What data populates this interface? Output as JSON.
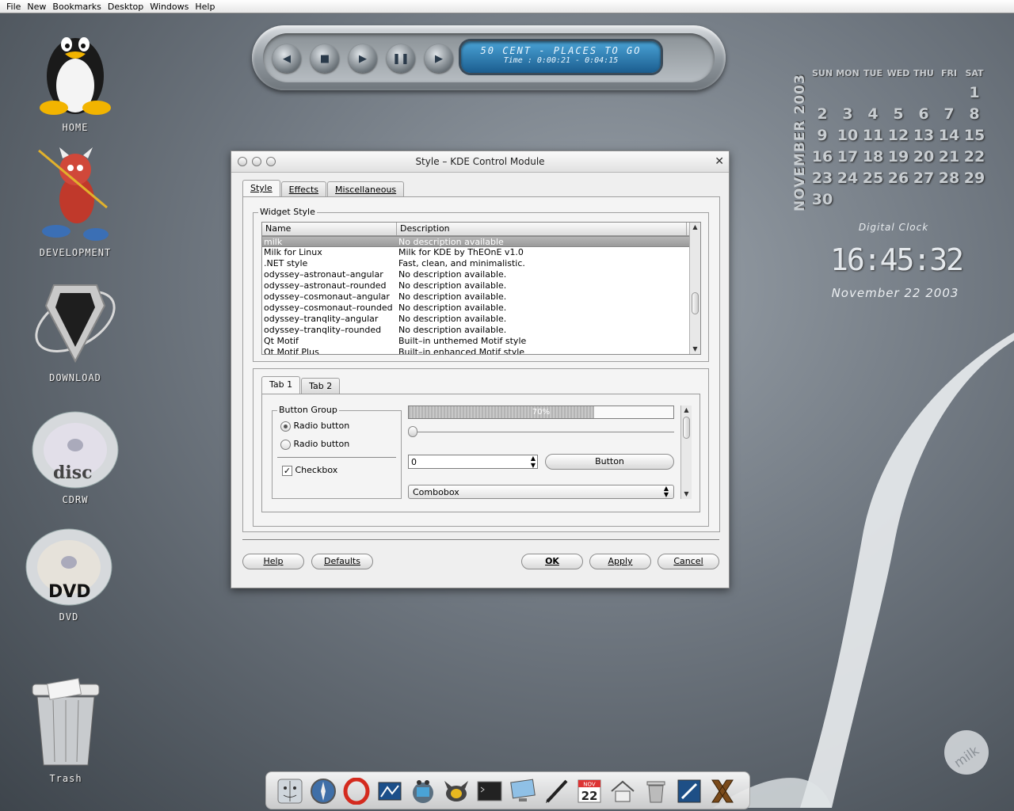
{
  "menubar": [
    "File",
    "New",
    "Bookmarks",
    "Desktop",
    "Windows",
    "Help"
  ],
  "desktop_icons": {
    "home": "HOME",
    "development": "DEVELOPMENT",
    "download": "DOWNLOAD",
    "cdrw": "CDRW",
    "dvd": "DVD",
    "trash": "Trash"
  },
  "player": {
    "track": "50 CENT - PLACES TO GO",
    "time": "Time : 0:00:21 - 0:04:15",
    "buttons": [
      "prev-icon",
      "stop-icon",
      "play-icon",
      "pause-icon",
      "next-icon"
    ]
  },
  "calendar": {
    "month_label": "NOVEMBER 2003",
    "weekdays": [
      "SUN",
      "MON",
      "TUE",
      "WED",
      "THU",
      "FRI",
      "SAT"
    ],
    "weeks": [
      [
        "",
        "",
        "",
        "",
        "",
        "",
        "1"
      ],
      [
        "2",
        "3",
        "4",
        "5",
        "6",
        "7",
        "8"
      ],
      [
        "9",
        "10",
        "11",
        "12",
        "13",
        "14",
        "15"
      ],
      [
        "16",
        "17",
        "18",
        "19",
        "20",
        "21",
        "22"
      ],
      [
        "23",
        "24",
        "25",
        "26",
        "27",
        "28",
        "29"
      ],
      [
        "30",
        "",
        "",
        "",
        "",
        "",
        ""
      ]
    ]
  },
  "clock": {
    "title": "Digital Clock",
    "time": "16:45:32",
    "date": "November 22 2003"
  },
  "dialog": {
    "title": "Style – KDE Control Module",
    "tabs": [
      "Style",
      "Effects",
      "Miscellaneous"
    ],
    "widget_style_label": "Widget Style",
    "columns": [
      "Name",
      "Description"
    ],
    "styles": [
      {
        "name": "milk",
        "desc": "No description available"
      },
      {
        "name": "Milk for Linux",
        "desc": "Milk for KDE by ThEOnE v1.0"
      },
      {
        "name": ".NET style",
        "desc": "Fast, clean, and minimalistic."
      },
      {
        "name": "odyssey–astronaut–angular",
        "desc": "No description available."
      },
      {
        "name": "odyssey–astronaut–rounded",
        "desc": "No description available."
      },
      {
        "name": "odyssey–cosmonaut–angular",
        "desc": "No description available."
      },
      {
        "name": "odyssey–cosmonaut–rounded",
        "desc": "No description available."
      },
      {
        "name": "odyssey–tranqlity–angular",
        "desc": "No description available."
      },
      {
        "name": "odyssey–tranqlity–rounded",
        "desc": "No description available."
      },
      {
        "name": "Qt Motif",
        "desc": "Built–in unthemed Motif style"
      },
      {
        "name": "Qt Motif Plus",
        "desc": "Built–in enhanced Motif style"
      }
    ],
    "selected_style": "milk",
    "preview": {
      "tabs": [
        "Tab 1",
        "Tab 2"
      ],
      "button_group_label": "Button Group",
      "radio1": "Radio button",
      "radio2": "Radio button",
      "checkbox": "Checkbox",
      "progress_text": "70%",
      "progress_value": 0.7,
      "spin_value": "0",
      "button": "Button",
      "combobox": "Combobox"
    },
    "buttons": {
      "help": "Help",
      "defaults": "Defaults",
      "ok": "OK",
      "apply": "Apply",
      "cancel": "Cancel"
    }
  },
  "dock": {
    "items": [
      "finder-icon",
      "safari-icon",
      "opera-icon",
      "konqueror-icon",
      "mail-icon",
      "gimp-icon",
      "terminal-icon",
      "monitor-icon",
      "pen-icon",
      "calendar-icon",
      "home-icon",
      "trash-icon",
      "kde-control-icon",
      "x11-icon"
    ],
    "calendar_month": "NOV",
    "calendar_day": "22"
  },
  "colors": {
    "lcd": "#2a7fb8",
    "selection": "#a8a8a8"
  }
}
